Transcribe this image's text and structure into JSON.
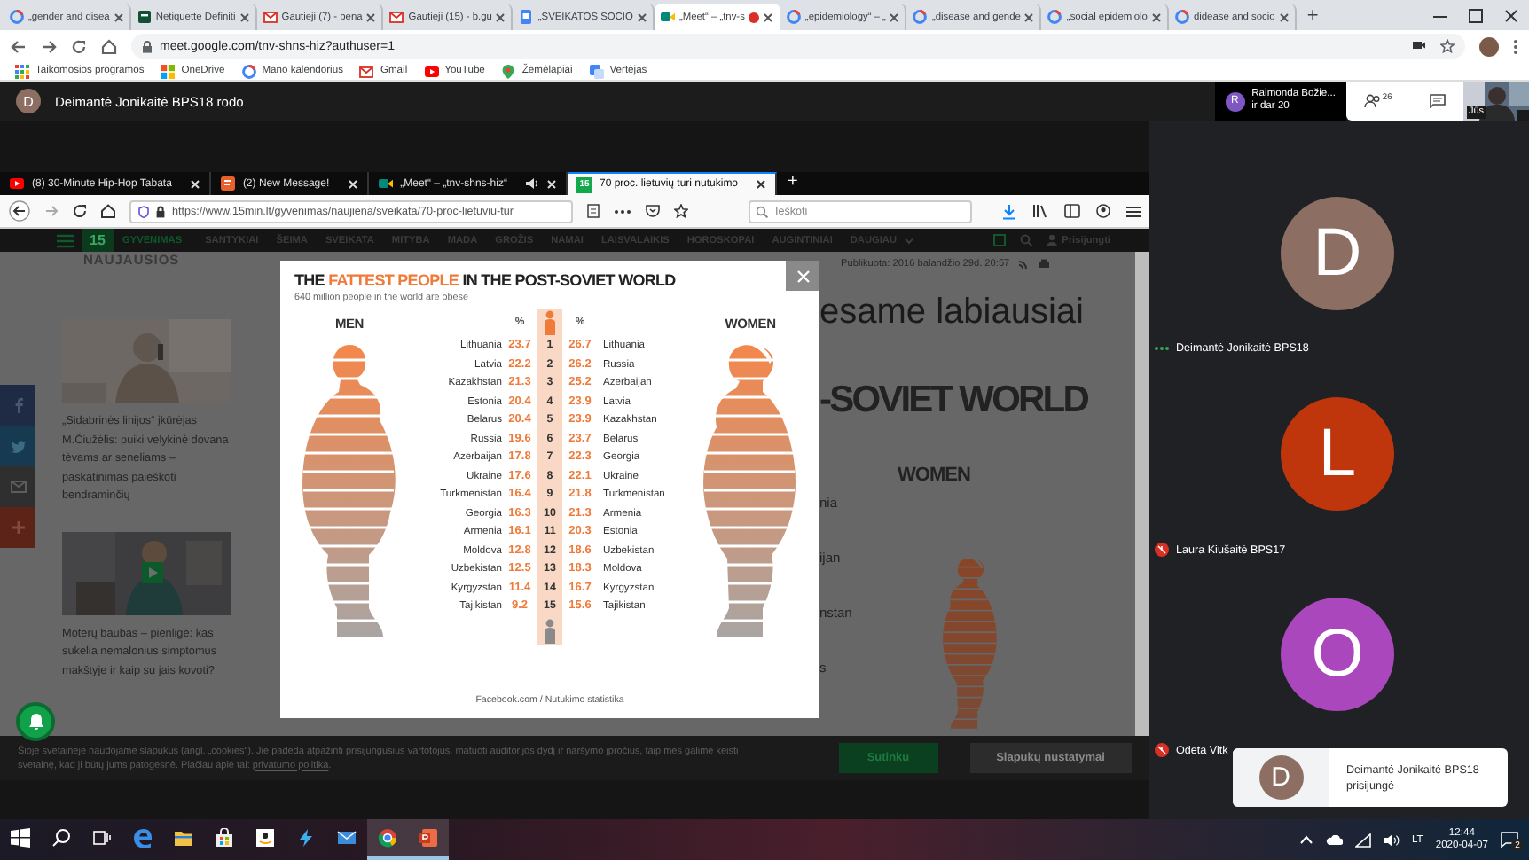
{
  "chrome": {
    "tabs": [
      {
        "label": "„gender and disea",
        "kind": "google",
        "selected": false,
        "recording": false
      },
      {
        "label": "Netiquette Definiti",
        "kind": "page",
        "selected": false,
        "recording": false
      },
      {
        "label": "Gautieji (7) - bena",
        "kind": "gmail",
        "selected": false,
        "recording": false
      },
      {
        "label": "Gautieji (15) - b.gu",
        "kind": "gmail",
        "selected": false,
        "recording": false
      },
      {
        "label": "„SVEIKATOS SOCIO",
        "kind": "sites",
        "selected": false,
        "recording": false
      },
      {
        "label": "„Meet“ – „tnv-s",
        "kind": "meet",
        "selected": true,
        "recording": true
      },
      {
        "label": "„epidemiology“ – „",
        "kind": "google",
        "selected": false,
        "recording": false
      },
      {
        "label": "„disease and gende",
        "kind": "google",
        "selected": false,
        "recording": false
      },
      {
        "label": "„social epidemiolo",
        "kind": "google",
        "selected": false,
        "recording": false
      },
      {
        "label": "didease and socio",
        "kind": "google",
        "selected": false,
        "recording": false
      }
    ],
    "new_tab": "+",
    "url": "meet.google.com/tnv-shns-hiz?authuser=1",
    "bookmarks": [
      {
        "label": "Taikomosios programos",
        "kind": "apps"
      },
      {
        "label": "OneDrive",
        "kind": "windows"
      },
      {
        "label": "Mano kalendorius",
        "kind": "google"
      },
      {
        "label": "Gmail",
        "kind": "gmail"
      },
      {
        "label": "YouTube",
        "kind": "youtube"
      },
      {
        "label": "Žemėlapiai",
        "kind": "maps"
      },
      {
        "label": "Vertėjas",
        "kind": "translate"
      }
    ]
  },
  "meet": {
    "presenter_initial": "D",
    "presenting_label": "Deimantė Jonikaitė BPS18 rodo",
    "chip": {
      "initial": "R",
      "name": "Raimonda Božie...",
      "more": "ir dar 20"
    },
    "people_count": "26",
    "self_label": "Jūs",
    "participants": [
      {
        "initial": "D",
        "name": "Deimantė Jonikaitė BPS18",
        "color": "#8d6e63",
        "muted": false
      },
      {
        "initial": "L",
        "name": "Laura Kiušaitė BPS17",
        "color": "#bf360c",
        "muted": true
      },
      {
        "initial": "O",
        "name": "Odeta Vitk",
        "color": "#ab47bc",
        "muted": true
      }
    ],
    "toast": {
      "initial": "D",
      "text": "Deimantė Jonikaitė BPS18 prisijungė"
    }
  },
  "shared": {
    "tabs": [
      {
        "label": "(8) 30-Minute Hip-Hop Tabata",
        "kind": "youtube",
        "selected": false,
        "audio": false
      },
      {
        "label": "(2) New Message!",
        "kind": "message",
        "selected": false,
        "audio": false
      },
      {
        "label": "„Meet“ – „tnv-shns-hiz“",
        "kind": "meet",
        "selected": false,
        "audio": true
      },
      {
        "label": "70 proc. lietuvių turi nutukimo",
        "kind": "site",
        "selected": true,
        "audio": false
      }
    ],
    "site_favicon": "15",
    "new_tab": "+",
    "url": "https://www.15min.lt/gyvenimas/naujiena/sveikata/70-proc-lietuviu-tur",
    "search_placeholder": "Ieškoti",
    "site": {
      "logo": "15",
      "section": "GYVENIMAS",
      "nav": [
        "SANTYKIAI",
        "ŠEIMA",
        "SVEIKATA",
        "MITYBA",
        "MADA",
        "GROŽIS",
        "NAMAI",
        "LAISVALAIKIS",
        "HOROSKOPAI",
        "AUGINTINIAI",
        "DAUGIAU"
      ],
      "login": "Prisijungti"
    },
    "sidebar_heading": "NAUJAUSIOS",
    "articles": [
      "„Sidabrinės linijos“ įkūrėjas M.Čiužėlis: puiki velykinė dovana tėvams ar seneliams – paskatinimas paieškoti bendraminčių",
      "Moterų baubas – pienligė: kas sukelia nemalonius simptomus makštyje ir kaip su jais kovoti?"
    ],
    "published": "Publikuota: 2016 balandžio 29d. 20:57",
    "headline_fragment": "esame labiausiai",
    "bg_title_fragment": "-SOVIET WORLD",
    "bg_women": "WOMEN",
    "bg_fragments": [
      "nia",
      "ijan",
      "nstan",
      "s"
    ],
    "infographic": {
      "title_lead": "THE",
      "title_highlight": "FATTEST PEOPLE",
      "title_rest": "IN THE POST-SOVIET WORLD",
      "subtitle": "640 million people in the world are obese",
      "men": "MEN",
      "women": "WOMEN",
      "men_pct": "%",
      "women_pct": "%",
      "rows": [
        {
          "rank": "1",
          "men_country": "Lithuania",
          "men_value": "23.7",
          "women_value": "26.7",
          "women_country": "Lithuania"
        },
        {
          "rank": "2",
          "men_country": "Latvia",
          "men_value": "22.2",
          "women_value": "26.2",
          "women_country": "Russia"
        },
        {
          "rank": "3",
          "men_country": "Kazakhstan",
          "men_value": "21.3",
          "women_value": "25.2",
          "women_country": "Azerbaijan"
        },
        {
          "rank": "4",
          "men_country": "Estonia",
          "men_value": "20.4",
          "women_value": "23.9",
          "women_country": "Latvia"
        },
        {
          "rank": "5",
          "men_country": "Belarus",
          "men_value": "20.4",
          "women_value": "23.9",
          "women_country": "Kazakhstan"
        },
        {
          "rank": "6",
          "men_country": "Russia",
          "men_value": "19.6",
          "women_value": "23.7",
          "women_country": "Belarus"
        },
        {
          "rank": "7",
          "men_country": "Azerbaijan",
          "men_value": "17.8",
          "women_value": "22.3",
          "women_country": "Georgia"
        },
        {
          "rank": "8",
          "men_country": "Ukraine",
          "men_value": "17.6",
          "women_value": "22.1",
          "women_country": "Ukraine"
        },
        {
          "rank": "9",
          "men_country": "Turkmenistan",
          "men_value": "16.4",
          "women_value": "21.8",
          "women_country": "Turkmenistan"
        },
        {
          "rank": "10",
          "men_country": "Georgia",
          "men_value": "16.3",
          "women_value": "21.3",
          "women_country": "Armenia"
        },
        {
          "rank": "11",
          "men_country": "Armenia",
          "men_value": "16.1",
          "women_value": "20.3",
          "women_country": "Estonia"
        },
        {
          "rank": "12",
          "men_country": "Moldova",
          "men_value": "12.8",
          "women_value": "18.6",
          "women_country": "Uzbekistan"
        },
        {
          "rank": "13",
          "men_country": "Uzbekistan",
          "men_value": "12.5",
          "women_value": "18.3",
          "women_country": "Moldova"
        },
        {
          "rank": "14",
          "men_country": "Kyrgyzstan",
          "men_value": "11.4",
          "women_value": "16.7",
          "women_country": "Kyrgyzstan"
        },
        {
          "rank": "15",
          "men_country": "Tajikistan",
          "men_value": "9.2",
          "women_value": "15.6",
          "women_country": "Tajikistan"
        }
      ],
      "source": "Facebook.com / Nutukimo statistika"
    },
    "cookie": {
      "text": "Šioje svetainėje naudojame slapukus (angl. „cookies“). Jie padeda atpažinti prisijungusius vartotojus, matuoti auditorijos dydį ir naršymo įpročius, taip mes galime keisti svetainę, kad ji būtų jums patogesnė. Plačiau apie tai: ",
      "link": "privatumo politika",
      "end": ".",
      "accept": "Sutinku",
      "settings": "Slapukų nustatymai"
    }
  },
  "taskbar": {
    "apps": [
      {
        "kind": "start",
        "active": false
      },
      {
        "kind": "search",
        "active": false
      },
      {
        "kind": "taskview",
        "active": false
      },
      {
        "kind": "edge",
        "active": false
      },
      {
        "kind": "explorer",
        "active": false
      },
      {
        "kind": "store",
        "active": false
      },
      {
        "kind": "amazon",
        "active": false
      },
      {
        "kind": "bolt",
        "active": false
      },
      {
        "kind": "mail",
        "active": false
      },
      {
        "kind": "chrome",
        "active": true
      },
      {
        "kind": "powerpoint",
        "active": true
      }
    ],
    "language": "LT",
    "time": "12:44",
    "date": "2020-04-07",
    "notifications": "2"
  }
}
